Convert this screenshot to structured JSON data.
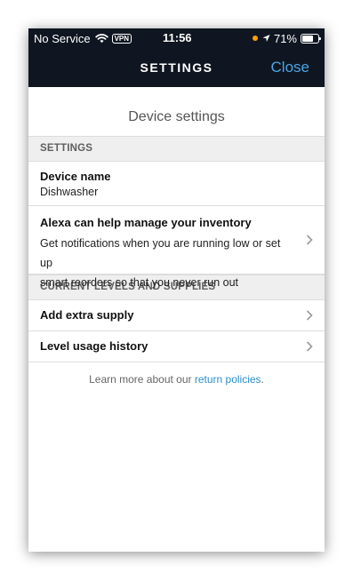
{
  "status_bar": {
    "carrier": "No Service",
    "vpn": "VPN",
    "time": "11:56",
    "battery": "71%",
    "battery_level": 0.71,
    "icons": [
      "wifi-icon",
      "location-icon",
      "battery-icon"
    ],
    "dot_color": "#ff9f0a"
  },
  "nav": {
    "title": "SETTINGS",
    "close_label": "Close",
    "bar_color": "#0f1621",
    "accent_color": "#4aa5e6"
  },
  "page": {
    "heading": "Device settings"
  },
  "sections": {
    "settings_header": "SETTINGS",
    "device_name_title": "Device name",
    "device_name_value": "Dishwasher",
    "alexa_title": "Alexa can help manage your inventory",
    "alexa_desc_line1": "Get notifications when you are running low or set up",
    "alexa_desc_line2": "smart reorders so that you never run out",
    "supplies_header": "CURRENT LEVELS AND SUPPLIES",
    "add_supply": "Add extra supply",
    "level_history": "Level usage history"
  },
  "footer": {
    "text": "Learn more about our ",
    "link": "return policies",
    "end": ".",
    "link_color": "#2b8fcc"
  }
}
